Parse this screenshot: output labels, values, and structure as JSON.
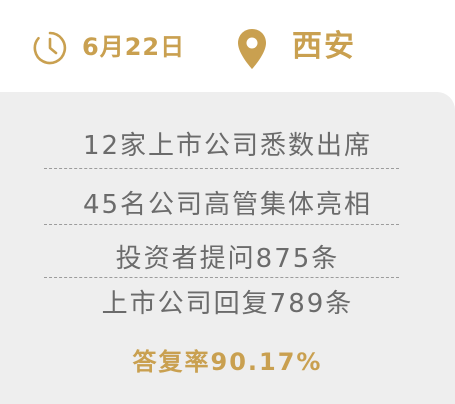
{
  "header": {
    "date": "6月22日",
    "city": "西安",
    "clock_icon": "clock-icon",
    "location_icon": "map-pin-icon"
  },
  "stats": [
    "12家上市公司悉数出席",
    "45名公司高管集体亮相",
    "投资者提问875条",
    "上市公司回复789条"
  ],
  "rate": "答复率90.17%",
  "colors": {
    "accent": "#c9a050",
    "panel_bg": "#eeeeee",
    "text": "#6b6b6b",
    "divider": "#9c9c9c"
  }
}
